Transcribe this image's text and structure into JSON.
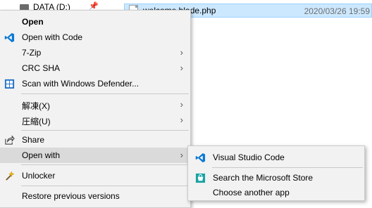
{
  "explorer": {
    "drive_label": "DATA (D:)",
    "file_name": "welcome.blade.php",
    "file_date": "2020/03/26 19:59"
  },
  "context_menu": {
    "items": [
      {
        "label": "Open",
        "bold": true,
        "icon": "none"
      },
      {
        "label": "Open with Code",
        "icon": "vscode-icon"
      },
      {
        "label": "7-Zip",
        "has_submenu": true,
        "icon": "none"
      },
      {
        "label": "CRC SHA",
        "has_submenu": true,
        "icon": "none"
      },
      {
        "label": "Scan with Windows Defender...",
        "icon": "windows-defender-icon"
      },
      {
        "label": "解凍(X)",
        "has_submenu": true,
        "icon": "none"
      },
      {
        "label": "圧縮(U)",
        "has_submenu": true,
        "icon": "none"
      },
      {
        "label": "Share",
        "icon": "share-icon"
      },
      {
        "label": "Open with",
        "has_submenu": true,
        "highlighted": true,
        "icon": "none"
      },
      {
        "label": "Unlocker",
        "icon": "unlocker-wand-icon"
      },
      {
        "label": "Restore previous versions",
        "icon": "none"
      }
    ]
  },
  "open_with_submenu": {
    "items": [
      {
        "label": "Visual Studio Code",
        "icon": "vscode-icon"
      },
      {
        "label": "Search the Microsoft Store",
        "icon": "microsoft-store-icon"
      },
      {
        "label": "Choose another app",
        "icon": "none"
      }
    ]
  },
  "colors": {
    "menu_bg": "#f2f2f2",
    "highlight": "#dadada",
    "selection": "#cce8ff",
    "vscode_blue": "#0a7ad4",
    "store_teal": "#1aa3a3"
  }
}
